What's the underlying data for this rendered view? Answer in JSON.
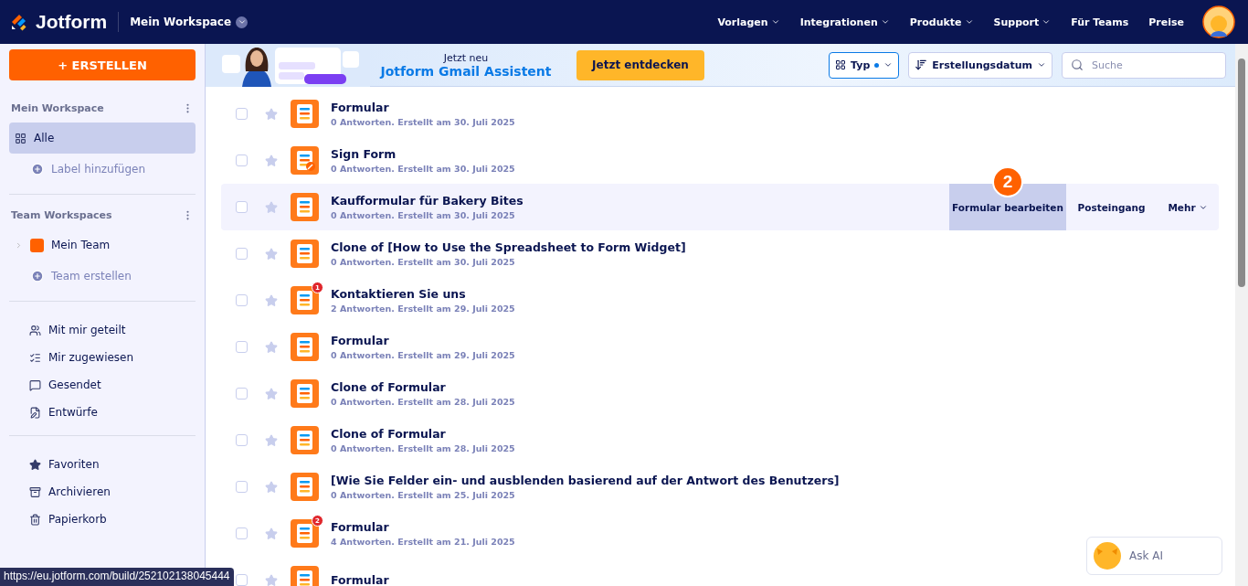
{
  "topbar": {
    "logo": "Jotform",
    "workspace": "Mein Workspace",
    "nav": [
      {
        "label": "Vorlagen",
        "dropdown": true
      },
      {
        "label": "Integrationen",
        "dropdown": true
      },
      {
        "label": "Produkte",
        "dropdown": true
      },
      {
        "label": "Support",
        "dropdown": true
      },
      {
        "label": "Für Teams",
        "dropdown": false
      },
      {
        "label": "Preise",
        "dropdown": false
      }
    ]
  },
  "sidebar": {
    "create_button": "+ ERSTELLEN",
    "sections": [
      {
        "title": "Mein Workspace",
        "items": [
          {
            "kind": "nav",
            "label": "Alle",
            "selected": true
          },
          {
            "kind": "add",
            "label": "Label hinzufügen",
            "selected": false
          }
        ]
      },
      {
        "title": "Team Workspaces",
        "items": [
          {
            "kind": "team",
            "label": "Mein Team",
            "selected": false
          },
          {
            "kind": "add",
            "label": "Team erstellen",
            "selected": false
          }
        ]
      },
      {
        "items": [
          {
            "kind": "nav",
            "label": "Mit mir geteilt",
            "selected": false
          },
          {
            "kind": "nav",
            "label": "Mir zugewiesen",
            "selected": false
          },
          {
            "kind": "nav",
            "label": "Gesendet",
            "selected": false
          },
          {
            "kind": "nav",
            "label": "Entwürfe",
            "selected": false
          }
        ]
      },
      {
        "items": [
          {
            "kind": "nav",
            "label": "Favoriten",
            "selected": false
          },
          {
            "kind": "nav",
            "label": "Archivieren",
            "selected": false
          },
          {
            "kind": "nav",
            "label": "Papierkorb",
            "selected": false
          }
        ]
      }
    ]
  },
  "banner": {
    "eyebrow": "Jetzt neu",
    "headline": "Jotform Gmail Assistent",
    "cta": "Jetzt entdecken"
  },
  "toolbar": {
    "type_filter": {
      "label": "Typ",
      "active": true
    },
    "sort": "Erstellungsdatum",
    "search": {
      "placeholder": "Suche"
    }
  },
  "forms": [
    {
      "title": "Formular",
      "subtitle": "0 Antworten. Erstellt am 30. Juli 2025",
      "kind": "form",
      "highlighted": false,
      "checked": false,
      "favorite": false
    },
    {
      "title": "Sign Form",
      "subtitle": "0 Antworten. Erstellt am 30. Juli 2025",
      "kind": "sign",
      "highlighted": false,
      "checked": false,
      "favorite": false
    },
    {
      "title": "Kaufformular für Bakery Bites",
      "subtitle": "0 Antworten. Erstellt am 30. Juli 2025",
      "kind": "form",
      "highlighted": true,
      "checked": false,
      "favorite": false,
      "actions": [
        {
          "label": "Formular bearbeiten",
          "selected": true,
          "dropdown": false,
          "step": "2"
        },
        {
          "label": "Posteingang",
          "selected": false,
          "dropdown": false
        },
        {
          "label": "Mehr",
          "selected": false,
          "dropdown": true
        }
      ]
    },
    {
      "title": "Clone of [How to Use the Spreadsheet to Form Widget]",
      "subtitle": "0 Antworten. Erstellt am 30. Juli 2025",
      "kind": "form",
      "highlighted": false,
      "checked": false,
      "favorite": false
    },
    {
      "title": "Kontaktieren Sie uns",
      "subtitle": "2 Antworten. Erstellt am 29. Juli 2025",
      "kind": "form",
      "badge": "1",
      "highlighted": false,
      "checked": false,
      "favorite": false
    },
    {
      "title": "Formular",
      "subtitle": "0 Antworten. Erstellt am 29. Juli 2025",
      "kind": "form",
      "highlighted": false,
      "checked": false,
      "favorite": false
    },
    {
      "title": "Clone of Formular",
      "subtitle": "0 Antworten. Erstellt am 28. Juli 2025",
      "kind": "form",
      "highlighted": false,
      "checked": false,
      "favorite": false
    },
    {
      "title": "Clone of Formular",
      "subtitle": "0 Antworten. Erstellt am 28. Juli 2025",
      "kind": "form",
      "highlighted": false,
      "checked": false,
      "favorite": false
    },
    {
      "title": "[Wie Sie Felder ein- und ausblenden basierend auf der Antwort des Benutzers]",
      "subtitle": "0 Antworten. Erstellt am 25. Juli 2025",
      "kind": "form",
      "highlighted": false,
      "checked": false,
      "favorite": false
    },
    {
      "title": "Formular",
      "subtitle": "4 Antworten. Erstellt am 21. Juli 2025",
      "kind": "form",
      "badge": "2",
      "highlighted": false,
      "checked": false,
      "favorite": false
    },
    {
      "title": "Formular",
      "kind": "form",
      "highlighted": false,
      "checked": false,
      "favorite": false
    }
  ],
  "ask_ai": "Ask AI",
  "status_url": "https://eu.jotform.com/build/252102138045444"
}
